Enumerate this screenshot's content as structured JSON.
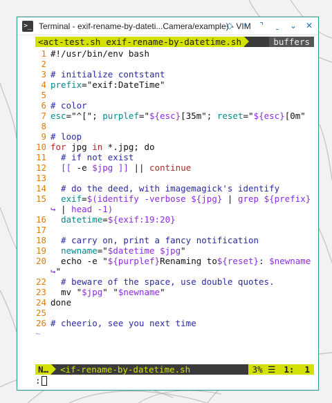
{
  "window": {
    "title": "Terminal - exif-rename-by-dateti...Camera/example) - VIM",
    "controls": [
      "diamond-icon",
      "dot-icon",
      "maximize-icon",
      "minimize-icon",
      "chevron-down-icon",
      "close-icon"
    ]
  },
  "tabline": {
    "inactive_tab": "<act-test.sh",
    "active_tab": " exif-rename-by-datetime.sh ",
    "right_label": "buffers"
  },
  "lines": [
    {
      "n": "1",
      "segs": [
        [
          "c-plain",
          "#!/usr/bin/env bash"
        ]
      ]
    },
    {
      "n": "2",
      "segs": []
    },
    {
      "n": "3",
      "segs": [
        [
          "c-comment",
          "# initialize contstant"
        ]
      ]
    },
    {
      "n": "4",
      "segs": [
        [
          "c-var",
          "prefix"
        ],
        [
          "c-plain",
          "="
        ],
        [
          "c-plain",
          "\"exif:DateTime\""
        ]
      ]
    },
    {
      "n": "5",
      "segs": []
    },
    {
      "n": "6",
      "segs": [
        [
          "c-comment",
          "# color"
        ]
      ]
    },
    {
      "n": "7",
      "segs": [
        [
          "c-var",
          "esc"
        ],
        [
          "c-plain",
          "=\"^[\"; "
        ],
        [
          "c-var",
          "purplef"
        ],
        [
          "c-plain",
          "=\""
        ],
        [
          "c-str",
          "${esc}"
        ],
        [
          "c-plain",
          "[35m\"; "
        ],
        [
          "c-var",
          "reset"
        ],
        [
          "c-plain",
          "=\""
        ],
        [
          "c-str",
          "${esc}"
        ],
        [
          "c-plain",
          "[0m\""
        ]
      ]
    },
    {
      "n": "8",
      "segs": []
    },
    {
      "n": "9",
      "segs": [
        [
          "c-comment",
          "# loop"
        ]
      ]
    },
    {
      "n": "10",
      "segs": [
        [
          "c-kw",
          "for"
        ],
        [
          "c-plain",
          " jpg "
        ],
        [
          "c-kw",
          "in"
        ],
        [
          "c-plain",
          " *.jpg; do"
        ]
      ]
    },
    {
      "n": "11",
      "segs": [
        [
          "c-comment",
          "  # if not exist"
        ]
      ]
    },
    {
      "n": "12",
      "segs": [
        [
          "c-plain",
          "  "
        ],
        [
          "c-brk",
          "[["
        ],
        [
          "c-plain",
          " -e "
        ],
        [
          "c-str",
          "$jpg"
        ],
        [
          "c-plain",
          " "
        ],
        [
          "c-brk",
          "]]"
        ],
        [
          "c-plain",
          " || "
        ],
        [
          "c-cond",
          "continue"
        ]
      ]
    },
    {
      "n": "13",
      "segs": []
    },
    {
      "n": "14",
      "segs": [
        [
          "c-comment",
          "  # do the deed, with imagemagick's identify"
        ]
      ]
    },
    {
      "n": "15",
      "segs": [
        [
          "c-plain",
          "  "
        ],
        [
          "c-var",
          "exif"
        ],
        [
          "c-plain",
          "="
        ],
        [
          "c-str",
          "$(identify -verbose ${jpg}"
        ],
        [
          "c-plain",
          " | "
        ],
        [
          "c-str",
          "grep ${prefix}"
        ]
      ]
    },
    {
      "n": "",
      "wrap": true,
      "segs": [
        [
          "c-plain",
          " | "
        ],
        [
          "c-str",
          "head -1)"
        ]
      ]
    },
    {
      "n": "16",
      "segs": [
        [
          "c-plain",
          "  "
        ],
        [
          "c-var",
          "datetime"
        ],
        [
          "c-plain",
          "="
        ],
        [
          "c-str",
          "${exif:19:20}"
        ]
      ]
    },
    {
      "n": "17",
      "segs": []
    },
    {
      "n": "18",
      "segs": [
        [
          "c-comment",
          "  # carry on, print a fancy notification"
        ]
      ]
    },
    {
      "n": "19",
      "segs": [
        [
          "c-plain",
          "  "
        ],
        [
          "c-var",
          "newname"
        ],
        [
          "c-plain",
          "=\""
        ],
        [
          "c-str",
          "$datetime $jpg"
        ],
        [
          "c-plain",
          "\""
        ]
      ]
    },
    {
      "n": "20",
      "segs": [
        [
          "c-plain",
          "  echo -e \""
        ],
        [
          "c-str",
          "${purplef}"
        ],
        [
          "c-plain",
          "Renaming to"
        ],
        [
          "c-str",
          "${reset}"
        ],
        [
          "c-plain",
          ": "
        ],
        [
          "c-str",
          "$newname"
        ]
      ]
    },
    {
      "n": "",
      "wrap": true,
      "segs": [
        [
          "c-plain",
          "\""
        ]
      ]
    },
    {
      "n": "22",
      "segs": [
        [
          "c-comment",
          "  # beware of the space, use double quotes."
        ]
      ]
    },
    {
      "n": "23",
      "segs": [
        [
          "c-plain",
          "  mv \""
        ],
        [
          "c-str",
          "$jpg"
        ],
        [
          "c-plain",
          "\" \""
        ],
        [
          "c-str",
          "$newname"
        ],
        [
          "c-plain",
          "\""
        ]
      ]
    },
    {
      "n": "24",
      "segs": [
        [
          "c-plain",
          "done"
        ]
      ]
    },
    {
      "n": "25",
      "segs": []
    },
    {
      "n": "26",
      "segs": [
        [
          "c-comment",
          "# cheerio, see you next time"
        ]
      ]
    }
  ],
  "statusline": {
    "mode": "N…",
    "file": "<if-rename-by-datetime.sh",
    "percent": "3% ☰",
    "position": "1:  1"
  },
  "cmdline": {
    "text": ":"
  }
}
